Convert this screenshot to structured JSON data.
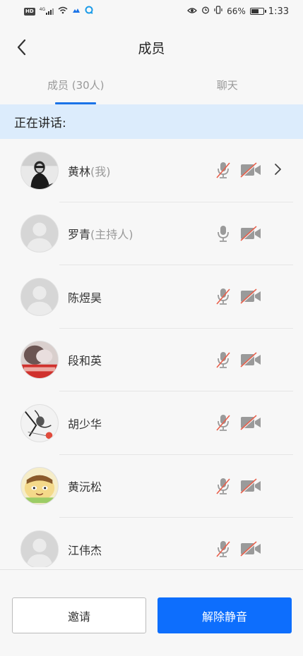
{
  "status_bar": {
    "network_badge": "HD",
    "signal": "4G",
    "battery": "66%",
    "battery_level": 0.66,
    "time": "1:33"
  },
  "header": {
    "title": "成员"
  },
  "tabs": [
    {
      "label": "成员 (30人)",
      "active": true
    },
    {
      "label": "聊天",
      "active": false
    }
  ],
  "speaking_label": "正在讲话:",
  "members": [
    {
      "name": "黄林",
      "role": "(我)",
      "avatar": "photo-woman",
      "mic_muted": true,
      "camera_off": true,
      "has_chevron": true
    },
    {
      "name": "罗青",
      "role": "(主持人)",
      "avatar": "default",
      "mic_muted": false,
      "camera_off": true,
      "has_chevron": false
    },
    {
      "name": "陈煜昊",
      "role": "",
      "avatar": "default",
      "mic_muted": true,
      "camera_off": true,
      "has_chevron": false
    },
    {
      "name": "段和英",
      "role": "",
      "avatar": "photo-red-banner",
      "mic_muted": true,
      "camera_off": true,
      "has_chevron": false
    },
    {
      "name": "胡少华",
      "role": "",
      "avatar": "photo-comic",
      "mic_muted": true,
      "camera_off": true,
      "has_chevron": false
    },
    {
      "name": "黄沅松",
      "role": "",
      "avatar": "photo-cartoon",
      "mic_muted": true,
      "camera_off": true,
      "has_chevron": false
    },
    {
      "name": "江伟杰",
      "role": "",
      "avatar": "default",
      "mic_muted": true,
      "camera_off": true,
      "has_chevron": false
    }
  ],
  "buttons": {
    "invite": "邀请",
    "unmute": "解除静音"
  },
  "colors": {
    "accent": "#0d6efd",
    "tab_underline": "#1a73e8",
    "speaking_bg": "#dcecfc",
    "mute_slash": "#e8604c"
  }
}
